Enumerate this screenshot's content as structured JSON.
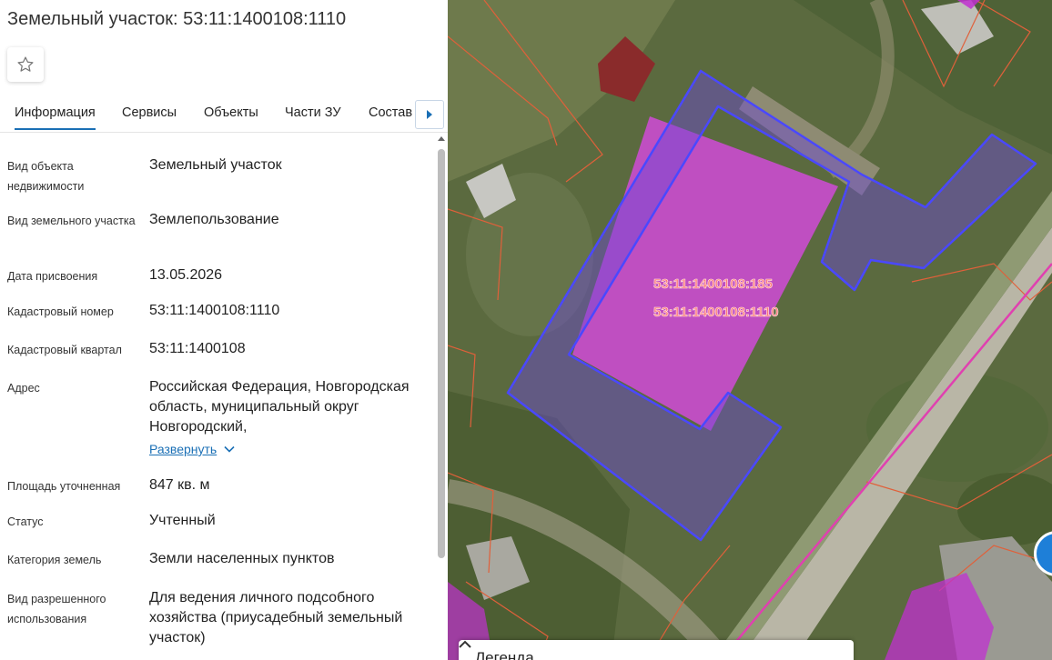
{
  "header": {
    "title": "Земельный участок: 53:11:1400108:1110"
  },
  "tabs": [
    {
      "label": "Информация",
      "active": true
    },
    {
      "label": "Сервисы"
    },
    {
      "label": "Объекты"
    },
    {
      "label": "Части ЗУ"
    },
    {
      "label": "Состав"
    }
  ],
  "info": [
    {
      "label": "Вид объекта недвижимости",
      "value": "Земельный участок"
    },
    {
      "label": "Вид земельного участка",
      "value": "Землепользование"
    },
    {
      "label": "Дата присвоения",
      "value": "13.05.2026"
    },
    {
      "label": "Кадастровый номер",
      "value": "53:11:1400108:1110"
    },
    {
      "label": "Кадастровый квартал",
      "value": "53:11:1400108"
    },
    {
      "label": "Адрес",
      "value": "Российская Федерация, Новгородская область, муниципальный округ Новгородский,"
    },
    {
      "label": "Площадь уточненная",
      "value": "847 кв. м"
    },
    {
      "label": "Статус",
      "value": "Учтенный"
    },
    {
      "label": "Категория земель",
      "value": "Земли населенных пунктов"
    },
    {
      "label": "Вид разрешенного использования",
      "value": "Для ведения личного подсобного хозяйства (приусадебный земельный участок)"
    }
  ],
  "address_expand": "Развернуть",
  "map": {
    "labels": [
      "53:11:1400108:185",
      "53:11:1400108:1110"
    ],
    "legend_title": "Легенда"
  },
  "colors": {
    "accent": "#1a6fb5",
    "parcel_fill": "#c030d0",
    "parcel_outline": "#4a48ff",
    "cadastral_line": "#e0603a"
  },
  "icons": [
    "star-icon",
    "chevron-right-icon",
    "chevron-down-icon",
    "chevron-up-icon"
  ]
}
